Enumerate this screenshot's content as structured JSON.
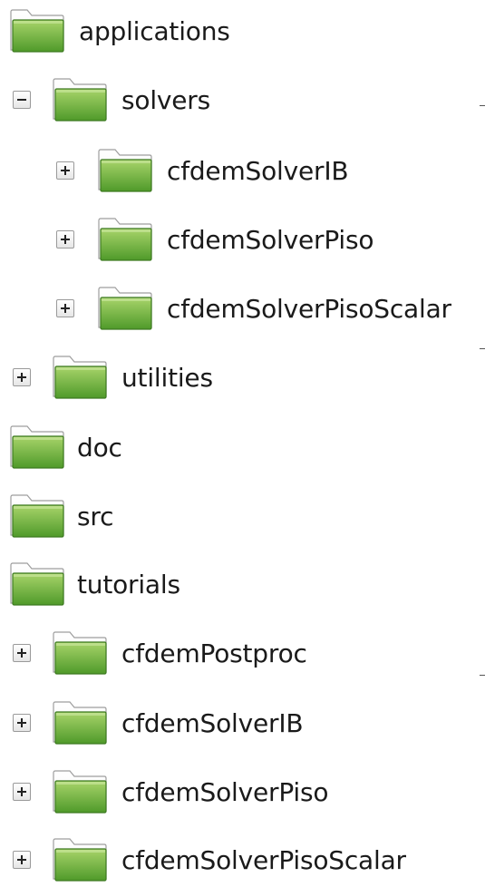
{
  "tree": [
    {
      "name": "applications",
      "depth": 0,
      "expander": "none"
    },
    {
      "name": "solvers",
      "depth": 1,
      "expander": "collapse"
    },
    {
      "name": "cfdemSolverIB",
      "depth": 2,
      "expander": "expand"
    },
    {
      "name": "cfdemSolverPiso",
      "depth": 2,
      "expander": "expand"
    },
    {
      "name": "cfdemSolverPisoScalar",
      "depth": 2,
      "expander": "expand"
    },
    {
      "name": "utilities",
      "depth": 1,
      "expander": "expand"
    },
    {
      "name": "doc",
      "depth": 0,
      "expander": "none"
    },
    {
      "name": "src",
      "depth": 0,
      "expander": "none"
    },
    {
      "name": "tutorials",
      "depth": 0,
      "expander": "none"
    },
    {
      "name": "cfdemPostproc",
      "depth": 1,
      "expander": "expand"
    },
    {
      "name": "cfdemSolverIB",
      "depth": 1,
      "expander": "expand"
    },
    {
      "name": "cfdemSolverPiso",
      "depth": 1,
      "expander": "expand"
    },
    {
      "name": "cfdemSolverPisoScalar",
      "depth": 1,
      "expander": "expand"
    }
  ],
  "icons": {
    "folder": "folder-icon",
    "expand": "plus-icon",
    "collapse": "minus-icon"
  },
  "colors": {
    "folder_green_light": "#a8d46a",
    "folder_green_dark": "#4f9a2a",
    "folder_tab": "#f4f4f4"
  }
}
